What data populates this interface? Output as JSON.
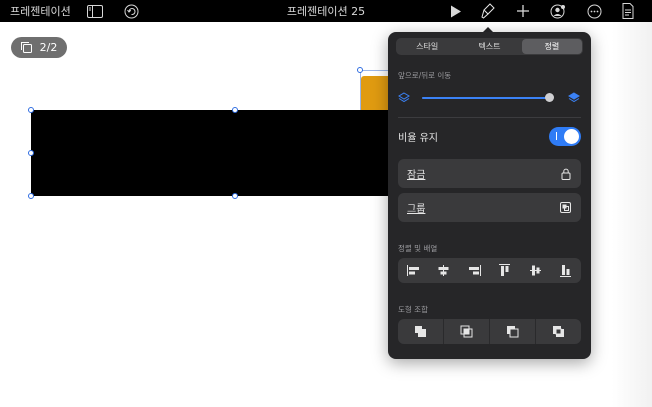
{
  "toolbar": {
    "app_label": "프레젠테이션",
    "document_title": "프레젠테이션 25",
    "icons": [
      "sidebar-icon",
      "undo-icon",
      "play-icon",
      "format-brush-icon",
      "add-icon",
      "collaborate-icon",
      "more-icon",
      "document-icon"
    ]
  },
  "slide_indicator": {
    "label": "2/2"
  },
  "popover": {
    "tabs": [
      {
        "label": "스타일",
        "active": false
      },
      {
        "label": "텍스트",
        "active": false
      },
      {
        "label": "정렬",
        "active": true
      }
    ],
    "move_section_label": "앞으로/뒤로 이동",
    "layer_position": 0.98,
    "keep_ratio": {
      "label": "비율 유지",
      "on": true
    },
    "lock": {
      "label": "잠금"
    },
    "group": {
      "label": "그룹"
    },
    "align_section_label": "정렬 및 배열",
    "combine_section_label": "도형 조합"
  },
  "colors": {
    "accent": "#2F7CF6",
    "shape_orange": "#E09B11",
    "popover_bg": "#262628",
    "row_bg": "#3A3A3C"
  }
}
